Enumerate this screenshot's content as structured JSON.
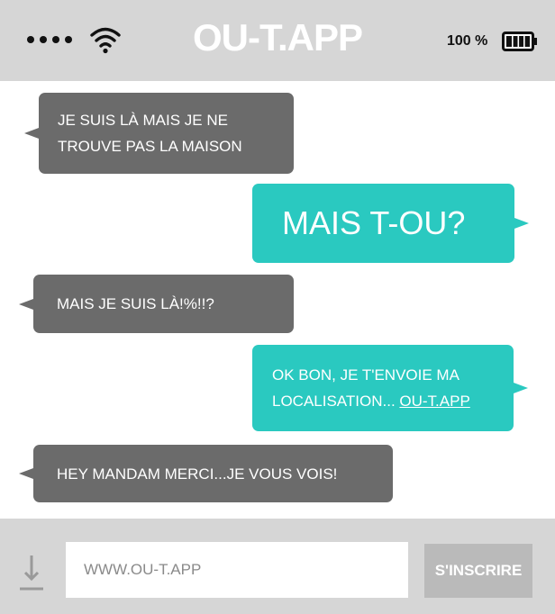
{
  "status_bar": {
    "title": "OU-T.APP",
    "battery": "100 %"
  },
  "messages": [
    {
      "side": "received",
      "text": "JE SUIS LÀ MAIS JE NE\nTROUVE PAS LA MAISON"
    },
    {
      "side": "sent",
      "text": "MAIS T-OU?"
    },
    {
      "side": "received",
      "text": "MAIS JE SUIS LÀ!%!!?"
    },
    {
      "side": "sent",
      "text": "OK BON, JE T'ENVOIE MA\nLOCALISATION... ",
      "link": "OU-T.APP"
    },
    {
      "side": "received",
      "text": "HEY MANDAM MERCI...JE VOUS VOIS!"
    }
  ],
  "input_bar": {
    "placeholder": "WWW.OU-T.APP",
    "button_label": "S'INSCRIRE"
  },
  "colors": {
    "received": "#6b6b6b",
    "sent": "#2ac9c0",
    "bar": "#d6d6d6"
  },
  "icons": [
    "signal-dots-icon",
    "wifi-icon",
    "battery-icon",
    "download-icon"
  ]
}
